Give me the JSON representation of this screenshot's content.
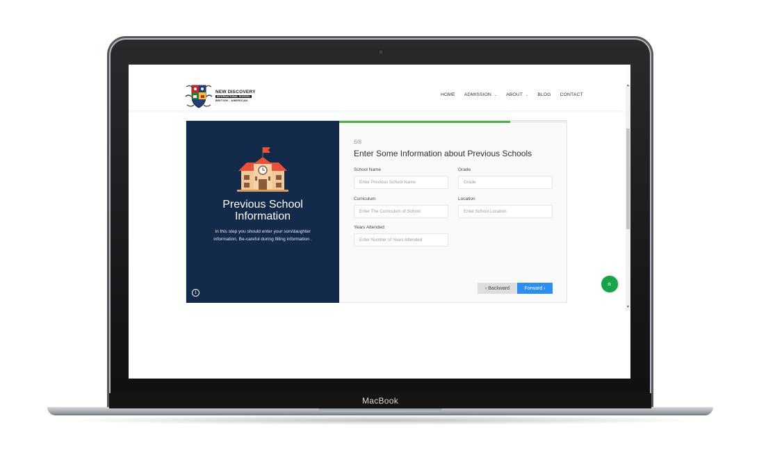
{
  "device": {
    "label": "MacBook"
  },
  "logo": {
    "line1": "NEW DISCOVERY",
    "line2": "INTERNATIONAL SCHOOL",
    "line3": "BRITISH - AMERICAN"
  },
  "nav": {
    "items": [
      {
        "label": "HOME",
        "dropdown": false
      },
      {
        "label": "ADMISSION",
        "dropdown": true
      },
      {
        "label": "ABOUT",
        "dropdown": true
      },
      {
        "label": "BLOG",
        "dropdown": false
      },
      {
        "label": "CONTACT",
        "dropdown": false
      }
    ]
  },
  "sidebar": {
    "illustration": "school-building-icon",
    "title_line1": "Previous School",
    "title_line2": "Information",
    "description": "In this step you should enter your son/daughter information, Be-careful during filling information ."
  },
  "form": {
    "step": "6/8",
    "progress": 0.75,
    "heading": "Enter Some Information about Previous Schools",
    "fields": {
      "school_name": {
        "label": "School Name",
        "placeholder": "Enter Previous School Name",
        "value": ""
      },
      "grade": {
        "label": "Grade",
        "placeholder": "Grade",
        "value": ""
      },
      "curriculum": {
        "label": "Curriculum",
        "placeholder": "Enter The Curriculum of School",
        "value": ""
      },
      "location": {
        "label": "Location",
        "placeholder": "Enter School Location",
        "value": ""
      },
      "years_attended": {
        "label": "Years Attended",
        "placeholder": "Enter Number of Years Attended",
        "value": ""
      }
    },
    "back_label": "‹ Backward",
    "forward_label": "Forward ›"
  },
  "colors": {
    "sidebar_bg": "#132a4b",
    "progress": "#4cb04a",
    "primary_button": "#2e8ff0",
    "scroll_top_button": "#17a34a"
  },
  "icons": {
    "info": "info-icon",
    "scroll_top": "double-chevron-up-icon"
  }
}
